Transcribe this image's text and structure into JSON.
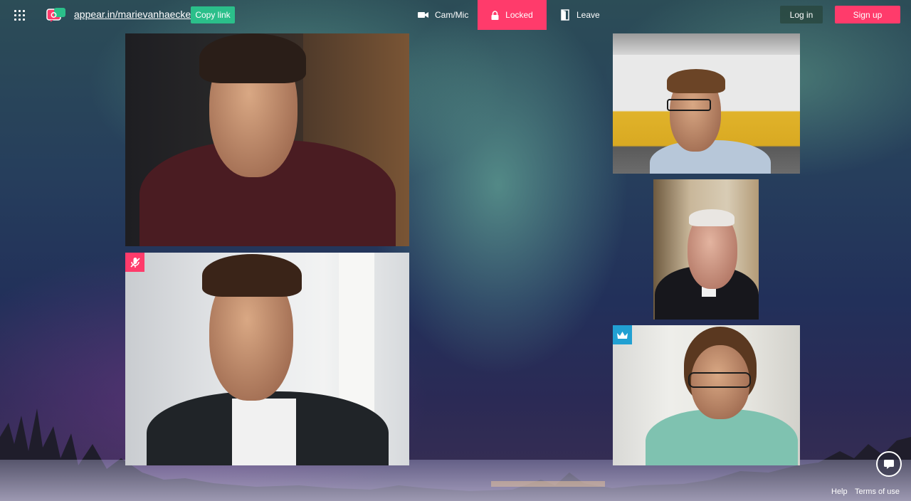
{
  "header": {
    "room_url": "appear.in/marievanhaecke",
    "copy_link_label": "Copy link",
    "cam_mic_label": "Cam/Mic",
    "locked_label": "Locked",
    "leave_label": "Leave",
    "login_label": "Log in",
    "signup_label": "Sign up"
  },
  "icons": {
    "menu": "grid-icon",
    "logo": "appear-in-logo",
    "cam": "video-camera-icon",
    "lock": "lock-icon",
    "leave": "door-exit-icon",
    "mute": "microphone-muted-icon",
    "owner": "crown-icon",
    "chat": "chat-bubble-icon"
  },
  "participants": [
    {
      "id": "participant-1",
      "muted": false,
      "owner": false
    },
    {
      "id": "participant-2",
      "muted": true,
      "owner": false
    },
    {
      "id": "participant-3",
      "muted": false,
      "owner": false
    },
    {
      "id": "participant-4",
      "muted": false,
      "owner": false
    },
    {
      "id": "participant-5",
      "muted": false,
      "owner": true
    }
  ],
  "colors": {
    "accent": "#ff3b6b",
    "copy_button": "#2bbf8a",
    "owner_badge": "#21a0d2"
  },
  "footer": {
    "help_label": "Help",
    "terms_label": "Terms of use"
  }
}
